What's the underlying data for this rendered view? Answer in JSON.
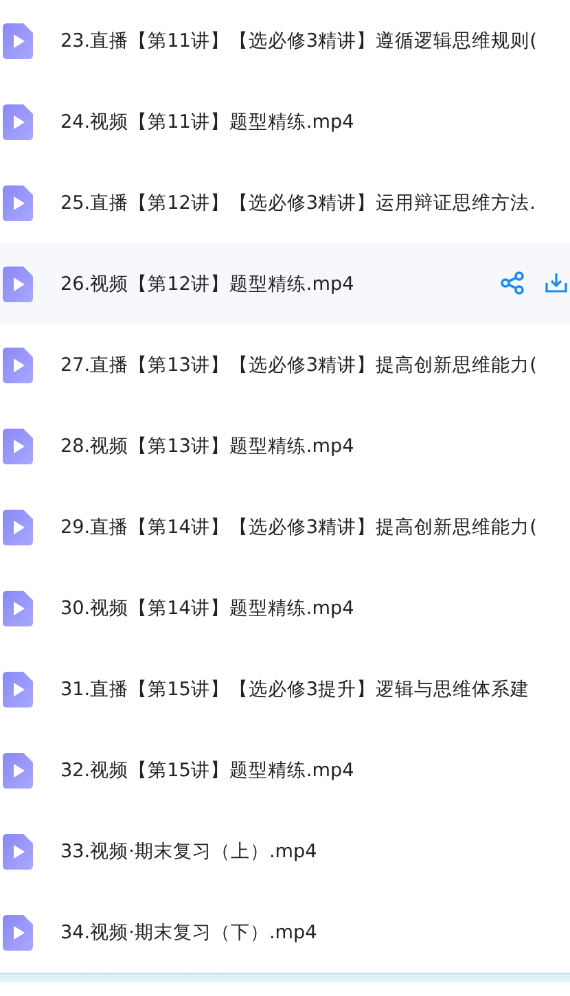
{
  "files": [
    {
      "name": "23.直播【第11讲】【选必修3精讲】遵循逻辑思维规则(",
      "selected": false
    },
    {
      "name": "24.视频【第11讲】题型精练.mp4",
      "selected": false
    },
    {
      "name": "25.直播【第12讲】【选必修3精讲】运用辩证思维方法.",
      "selected": false
    },
    {
      "name": "26.视频【第12讲】题型精练.mp4",
      "selected": true
    },
    {
      "name": "27.直播【第13讲】【选必修3精讲】提高创新思维能力(",
      "selected": false
    },
    {
      "name": "28.视频【第13讲】题型精练.mp4",
      "selected": false
    },
    {
      "name": "29.直播【第14讲】【选必修3精讲】提高创新思维能力(",
      "selected": false
    },
    {
      "name": "30.视频【第14讲】题型精练.mp4",
      "selected": false
    },
    {
      "name": "31.直播【第15讲】【选必修3提升】逻辑与思维体系建",
      "selected": false
    },
    {
      "name": "32.视频【第15讲】题型精练.mp4",
      "selected": false
    },
    {
      "name": "33.视频·期末复习（上）.mp4",
      "selected": false
    },
    {
      "name": "34.视频·期末复习（下）.mp4",
      "selected": false
    }
  ]
}
